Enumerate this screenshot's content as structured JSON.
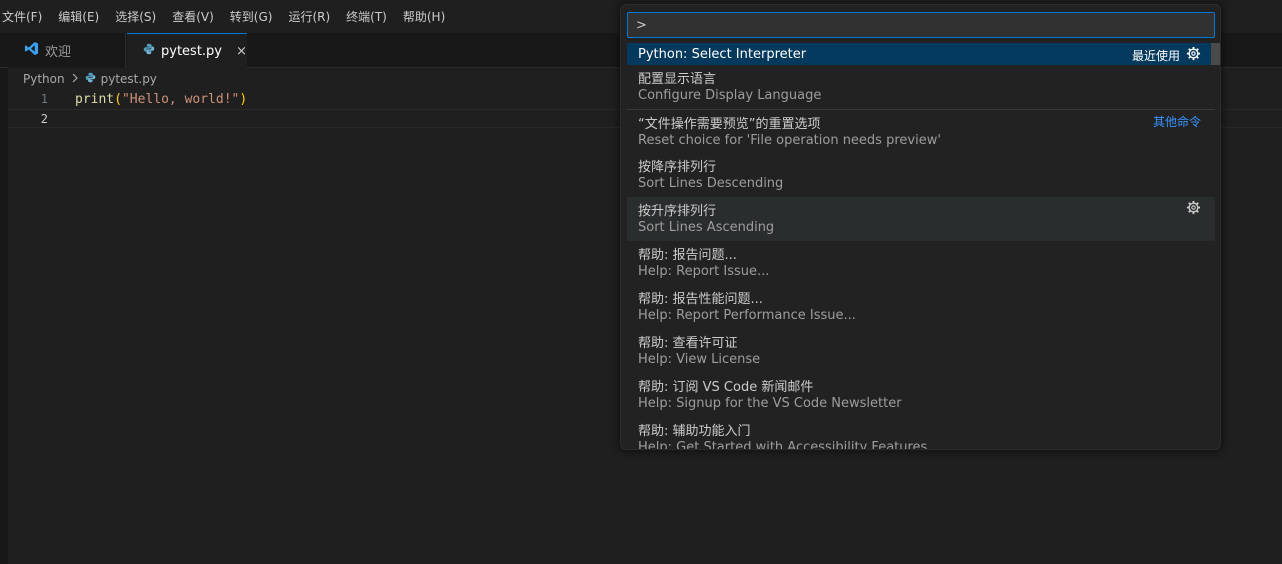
{
  "menu": [
    "文件(F)",
    "编辑(E)",
    "选择(S)",
    "查看(V)",
    "转到(G)",
    "运行(R)",
    "终端(T)",
    "帮助(H)"
  ],
  "tabs": {
    "welcome": "欢迎",
    "active": "pytest.py",
    "close_icon": "×"
  },
  "breadcrumb": {
    "folder": "Python",
    "file": "pytest.py"
  },
  "editor": {
    "line_numbers": [
      "1",
      "2"
    ],
    "line1": {
      "fn": "print",
      "open": "(",
      "str": "\"Hello, world!\"",
      "close": ")"
    }
  },
  "palette": {
    "input_value": ">",
    "recent_label": "最近使用",
    "other_commands_label": "其他命令",
    "items": [
      {
        "label": "Python: Select Interpreter"
      },
      {
        "label": "配置显示语言",
        "desc": "Configure Display Language"
      },
      {
        "label": "“文件操作需要预览”的重置选项",
        "desc": "Reset choice for 'File operation needs preview'"
      },
      {
        "label": "按降序排列行",
        "desc": "Sort Lines Descending"
      },
      {
        "label": "按升序排列行",
        "desc": "Sort Lines Ascending"
      },
      {
        "label": "帮助: 报告问题...",
        "desc": "Help: Report Issue..."
      },
      {
        "label": "帮助: 报告性能问题...",
        "desc": "Help: Report Performance Issue..."
      },
      {
        "label": "帮助: 查看许可证",
        "desc": "Help: View License"
      },
      {
        "label": "帮助: 订阅 VS Code 新闻邮件",
        "desc": "Help: Signup for the VS Code Newsletter"
      },
      {
        "label": "帮助: 辅助功能入门",
        "desc": "Help: Get Started with Accessibility Features"
      }
    ]
  },
  "colors": {
    "accent": "#0078d4",
    "selection": "#04395e",
    "link": "#3794ff"
  },
  "icons": [
    "vscode-icon",
    "python-icon",
    "close-icon",
    "chevron-right-icon",
    "gear-icon"
  ]
}
